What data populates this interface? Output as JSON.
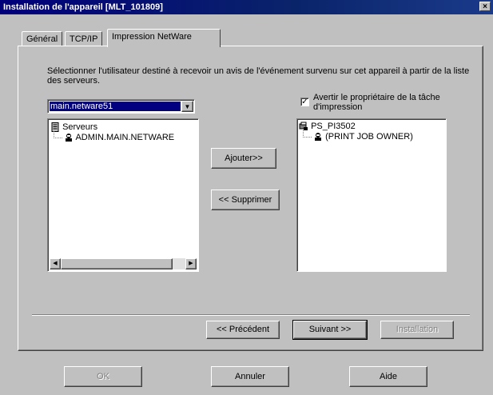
{
  "window": {
    "title": "Installation de l'appareil [MLT_101809]",
    "close_label": "×"
  },
  "tabs": [
    {
      "label": "Général",
      "active": false
    },
    {
      "label": "TCP/IP",
      "active": false
    },
    {
      "label": "Impression NetWare",
      "active": true
    }
  ],
  "description": "Sélectionner l'utilisateur destiné à recevoir un avis de l'événement survenu sur cet appareil à partir de la liste des serveurs.",
  "server_combo": {
    "value": "main.netware51"
  },
  "servers_tree": {
    "root": "Serveurs",
    "child": "ADMIN.MAIN.NETWARE"
  },
  "add_button": "Ajouter>>",
  "remove_button": "<< Supprimer",
  "notify_checkbox": {
    "label": "Avertir le propriétaire de la tâche d'impression",
    "checked": true
  },
  "recipients_tree": {
    "root": "PS_PI3502",
    "child": "(PRINT JOB OWNER)"
  },
  "wizard": {
    "previous": "<< Précédent",
    "next": "Suivant >>",
    "install": "Installation"
  },
  "footer": {
    "ok": "OK",
    "cancel": "Annuler",
    "help": "Aide"
  }
}
